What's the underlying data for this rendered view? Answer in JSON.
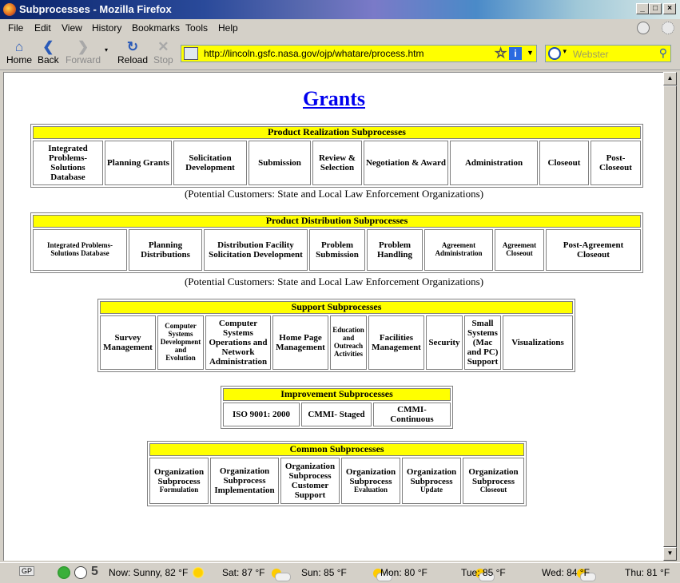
{
  "window": {
    "title": "Subprocesses - Mozilla Firefox"
  },
  "menu": [
    "File",
    "Edit",
    "View",
    "History",
    "Bookmarks",
    "Tools",
    "Help"
  ],
  "nav": {
    "home": "Home",
    "back": "Back",
    "forward": "Forward",
    "reload": "Reload",
    "stop": "Stop"
  },
  "url": "http://lincoln.gsfc.nasa.gov/ojp/whatare/process.htm",
  "search": {
    "placeholder": "Webster"
  },
  "page": {
    "heading": "Grants",
    "realization": {
      "title": "Product Realization Subprocesses",
      "items": [
        "Integrated Problems-Solutions Database",
        "Planning Grants",
        "Solicitation Development",
        "Submission",
        "Review & Selection",
        "Negotiation & Award",
        "Administration",
        "Closeout",
        "Post-Closeout"
      ],
      "note": "(Potential Customers: State and Local Law Enforcement Organizations)"
    },
    "distribution": {
      "title": "Product Distribution Subprocesses",
      "items": [
        "Integrated Problems-Solutions Database",
        "Planning Distributions",
        "Distribution Facility Solicitation Development",
        "Problem Submission",
        "Problem Handling",
        "Agreement Administration",
        "Agreement Closeout",
        "Post-Agreement Closeout"
      ],
      "note": "(Potential Customers: State and Local Law Enforcement Organizations)"
    },
    "support": {
      "title": "Support Subprocesses",
      "items": [
        "Survey Management",
        "Computer Systems Development and Evolution",
        "Computer Systems Operations and Network Administration",
        "Home Page Management",
        "Education and Outreach Activities",
        "Facilities Management",
        "Security",
        "Small Systems (Mac and PC) Support",
        "Visualizations"
      ]
    },
    "improvement": {
      "title": "Improvement Subprocesses",
      "items": [
        "ISO 9001: 2000",
        "CMMI- Staged",
        "CMMI- Continuous"
      ]
    },
    "common": {
      "title": "Common Subprocesses",
      "items": [
        {
          "a": "Organization Subprocess",
          "b": "Formulation"
        },
        {
          "a": "Organization Subprocess",
          "b": "Implementation"
        },
        {
          "a": "Organization Subprocess",
          "b": "Customer Support"
        },
        {
          "a": "Organization Subprocess",
          "b": "Evaluation"
        },
        {
          "a": "Organization Subprocess",
          "b": "Update"
        },
        {
          "a": "Organization Subprocess",
          "b": "Closeout"
        }
      ]
    }
  },
  "status": {
    "gp": "GP",
    "count": "5",
    "now": "Now: Sunny, 82 °F",
    "sat": "Sat: 87 °F",
    "sun": "Sun: 85 °F",
    "mon": "Mon: 80 °F",
    "tue": "Tue: 85 °F",
    "wed": "Wed: 84 °F",
    "thu": "Thu: 81 °F"
  },
  "icons": {
    "home": "house-icon",
    "back": "arrow-left-icon",
    "forward": "arrow-right-icon",
    "reload": "reload-icon",
    "stop": "x-icon"
  }
}
